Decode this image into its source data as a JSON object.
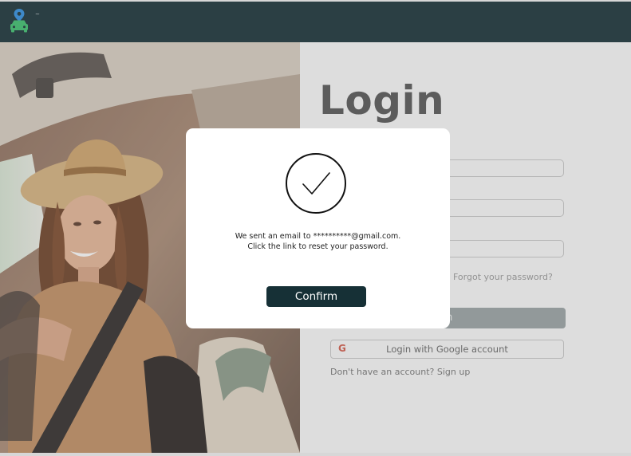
{
  "header": {
    "logo_text": "~"
  },
  "login": {
    "title": "Login",
    "forgot_link": "Forgot your password?",
    "login_button": "Login",
    "login_button_visible": "in",
    "google_button": "Login with Google account",
    "google_glyph": "G",
    "signup_text": "Don't have an account? Sign up"
  },
  "modal": {
    "message": "We sent an email to **********@gmail.com. Click the link to reset your password.",
    "confirm_label": "Confirm"
  },
  "colors": {
    "brand_dark": "#163036",
    "accent_green": "#3cbf6e",
    "pin_blue": "#2f8fe0"
  }
}
